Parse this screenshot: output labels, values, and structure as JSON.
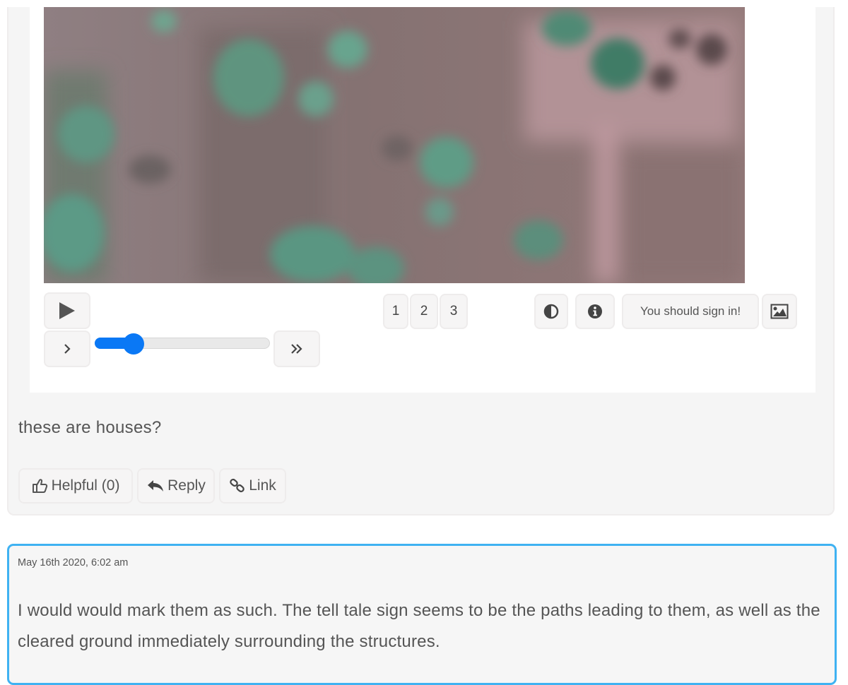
{
  "subject": {
    "image_alt": "Satellite image of terrain with vegetation and cleared ground",
    "controls": {
      "play_icon": "play-icon",
      "step_icon": "chevron-right-icon",
      "fast_forward_icon": "double-chevron-right-icon",
      "slider_position": 0.22,
      "frames": [
        "1",
        "2",
        "3"
      ],
      "invert_icon": "contrast-icon",
      "info_icon": "info-circle-icon",
      "signin_label": "You should sign in!",
      "image_icon": "image-icon"
    }
  },
  "post": {
    "text": "these are houses?",
    "actions": {
      "helpful_label": "Helpful (0)",
      "helpful_icon": "thumbs-up-icon",
      "reply_label": "Reply",
      "reply_icon": "reply-icon",
      "link_label": "Link",
      "link_icon": "link-icon"
    }
  },
  "reply_comment": {
    "timestamp": "May 16th 2020, 6:02 am",
    "body": "I would would mark them as such. The tell tale sign seems to be the paths leading to them, as well as the cleared ground immediately surrounding the structures.",
    "accent_color": "#3fb2f2"
  },
  "colors": {
    "slider_accent": "#0a78f5",
    "card_background": "#f5f5f5"
  }
}
